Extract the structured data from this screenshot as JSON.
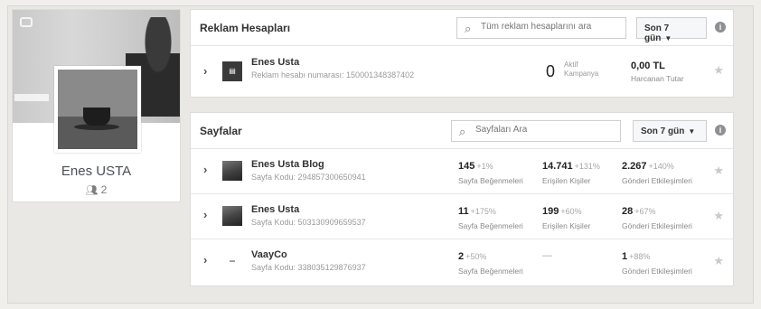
{
  "profile": {
    "name": "Enes USTA",
    "people_count": "2"
  },
  "ad_accounts": {
    "title": "Reklam Hesapları",
    "search_placeholder": "Tüm reklam hesaplarını ara",
    "range_label": "Son 7 gün",
    "info_label": "i",
    "rows": [
      {
        "name": "Enes Usta",
        "subtitle": "Reklam hesabı numarası: 150001348387402",
        "active_count": "0",
        "active_label_1": "Aktif",
        "active_label_2": "Kampanya",
        "spend_value": "0,00 TL",
        "spend_label": "Harcanan Tutar"
      }
    ]
  },
  "pages": {
    "title": "Sayfalar",
    "search_placeholder": "Sayfaları Ara",
    "range_label": "Son 7 gün",
    "info_label": "i",
    "rows": [
      {
        "name": "Enes Usta Blog",
        "subtitle": "Sayfa Kodu: 294857300650941",
        "likes": "145",
        "likes_change": "+1%",
        "likes_label": "Sayfa Beğenmeleri",
        "reach": "14.741",
        "reach_change": "+131%",
        "reach_label": "Erişilen Kişiler",
        "engagement": "2.267",
        "engagement_change": "+140%",
        "engagement_label": "Gönderi Etkileşimleri"
      },
      {
        "name": "Enes Usta",
        "subtitle": "Sayfa Kodu: 503130909659537",
        "likes": "11",
        "likes_change": "+175%",
        "likes_label": "Sayfa Beğenmeleri",
        "reach": "199",
        "reach_change": "+60%",
        "reach_label": "Erişilen Kişiler",
        "engagement": "28",
        "engagement_change": "+67%",
        "engagement_label": "Gönderi Etkileşimleri"
      },
      {
        "name": "VaayCo",
        "subtitle": "Sayfa Kodu: 338035129876937",
        "likes": "2",
        "likes_change": "+50%",
        "likes_label": "Sayfa Beğenmeleri",
        "reach_dash": "—",
        "engagement": "1",
        "engagement_change": "+88%",
        "engagement_label": "Gönderi Etkileşimleri"
      }
    ]
  }
}
